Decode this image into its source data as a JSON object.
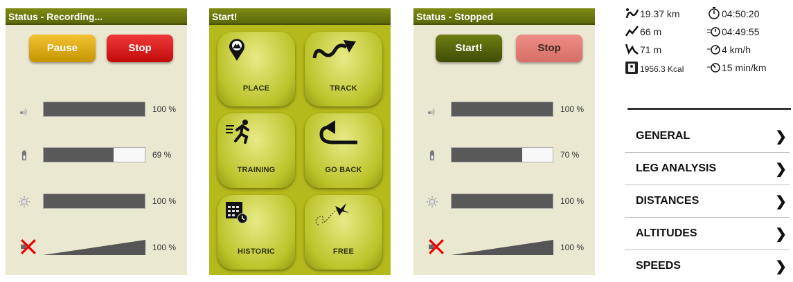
{
  "panel_recording": {
    "title": "Status - Recording...",
    "pause_label": "Pause",
    "stop_label": "Stop",
    "metrics": [
      {
        "icon": "gps-signal-icon",
        "value": 1.0,
        "label": "100 %"
      },
      {
        "icon": "battery-icon",
        "value": 0.69,
        "label": "69 %"
      },
      {
        "icon": "brightness-icon",
        "value": 1.0,
        "label": "100 %"
      },
      {
        "icon": "volume-muted-icon",
        "value": 1.0,
        "label": "100 %"
      }
    ]
  },
  "panel_start": {
    "title": "Start!",
    "tiles": [
      {
        "icon": "place-pin-icon",
        "label": "PLACE"
      },
      {
        "icon": "track-icon",
        "label": "TRACK"
      },
      {
        "icon": "training-runner-icon",
        "label": "TRAINING"
      },
      {
        "icon": "go-back-icon",
        "label": "GO BACK"
      },
      {
        "icon": "historic-calendar-icon",
        "label": "HISTORIC"
      },
      {
        "icon": "free-bird-icon",
        "label": "FREE"
      }
    ]
  },
  "panel_stopped": {
    "title": "Status - Stopped",
    "start_label": "Start!",
    "stop_label": "Stop",
    "metrics": [
      {
        "icon": "gps-signal-icon",
        "value": 1.0,
        "label": "100 %"
      },
      {
        "icon": "battery-icon",
        "value": 0.7,
        "label": "70 %"
      },
      {
        "icon": "brightness-icon",
        "value": 1.0,
        "label": "100 %"
      },
      {
        "icon": "volume-muted-icon",
        "value": 1.0,
        "label": "100 %"
      }
    ]
  },
  "stats": {
    "distance": "19.37 km",
    "total_time": "04:50:20",
    "ascent": "66 m",
    "moving_time": "04:49:55",
    "descent": "71 m",
    "speed": "4 km/h",
    "calories": "1956.3 Kcal",
    "pace": "15 min/km"
  },
  "menu": [
    {
      "label": "GENERAL"
    },
    {
      "label": "LEG ANALYSIS"
    },
    {
      "label": "DISTANCES"
    },
    {
      "label": "ALTITUDES"
    },
    {
      "label": "SPEEDS"
    }
  ],
  "colors": {
    "panel_bg": "#ebe8d1",
    "title_green": "#6a750e",
    "tile_bg": "#b5ba1c",
    "pause": "#e2ad12",
    "stop": "#d91f1f"
  }
}
